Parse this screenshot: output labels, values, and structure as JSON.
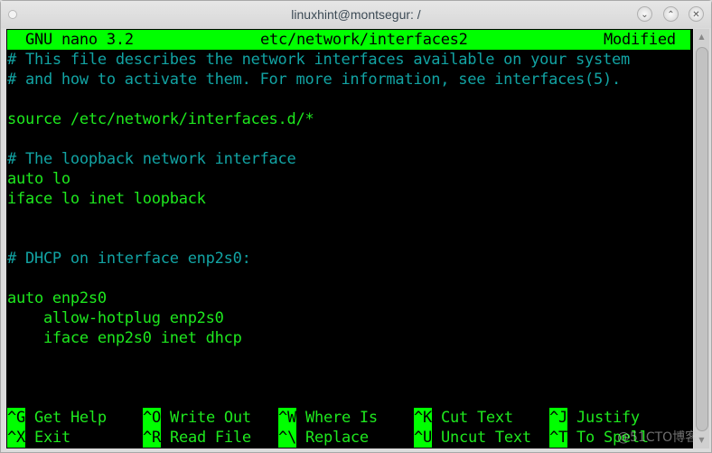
{
  "window": {
    "title": "linuxhint@montsegur: /",
    "buttons": {
      "minimize": "⌄",
      "maximize": "⌃",
      "close": "✕"
    }
  },
  "nano": {
    "app": "GNU nano 3.2",
    "filename": "etc/network/interfaces2",
    "status": "Modified"
  },
  "lines": [
    {
      "text": "# This file describes the network interfaces available on your system",
      "type": "comment",
      "row": 2
    },
    {
      "text": "# and how to activate them. For more information, see interfaces(5).",
      "type": "comment",
      "row": 3
    },
    {
      "text": "source /etc/network/interfaces.d/*",
      "type": "code",
      "row": 5
    },
    {
      "text": "# The loopback network interface",
      "type": "comment",
      "row": 7
    },
    {
      "text": "auto lo",
      "type": "code",
      "row": 8
    },
    {
      "text": "iface lo inet loopback",
      "type": "code",
      "row": 9
    },
    {
      "text": "# DHCP on interface enp2s0:",
      "type": "comment",
      "row": 12
    },
    {
      "text": "auto enp2s0",
      "type": "code",
      "row": 14
    },
    {
      "text": "    allow-hotplug enp2s0",
      "type": "code",
      "row": 15
    },
    {
      "text": "    iface enp2s0 inet dhcp",
      "type": "code",
      "row": 16
    }
  ],
  "shortcuts": [
    [
      {
        "key": "^G",
        "label": "Get Help"
      },
      {
        "key": "^O",
        "label": "Write Out"
      },
      {
        "key": "^W",
        "label": "Where Is"
      },
      {
        "key": "^K",
        "label": "Cut Text"
      },
      {
        "key": "^J",
        "label": "Justify"
      }
    ],
    [
      {
        "key": "^X",
        "label": "Exit"
      },
      {
        "key": "^R",
        "label": "Read File"
      },
      {
        "key": "^\\",
        "label": "Replace"
      },
      {
        "key": "^U",
        "label": "Uncut Text"
      },
      {
        "key": "^T",
        "label": "To Spell"
      }
    ]
  ],
  "scrollbar": {
    "up_arrow": "▲",
    "down_arrow": "▼"
  },
  "watermark": "@51CTO博客",
  "colors": {
    "header_bg": "#00ff00",
    "comment": "#12a3a3",
    "code": "#1ee81e",
    "terminal_bg": "#000000"
  }
}
